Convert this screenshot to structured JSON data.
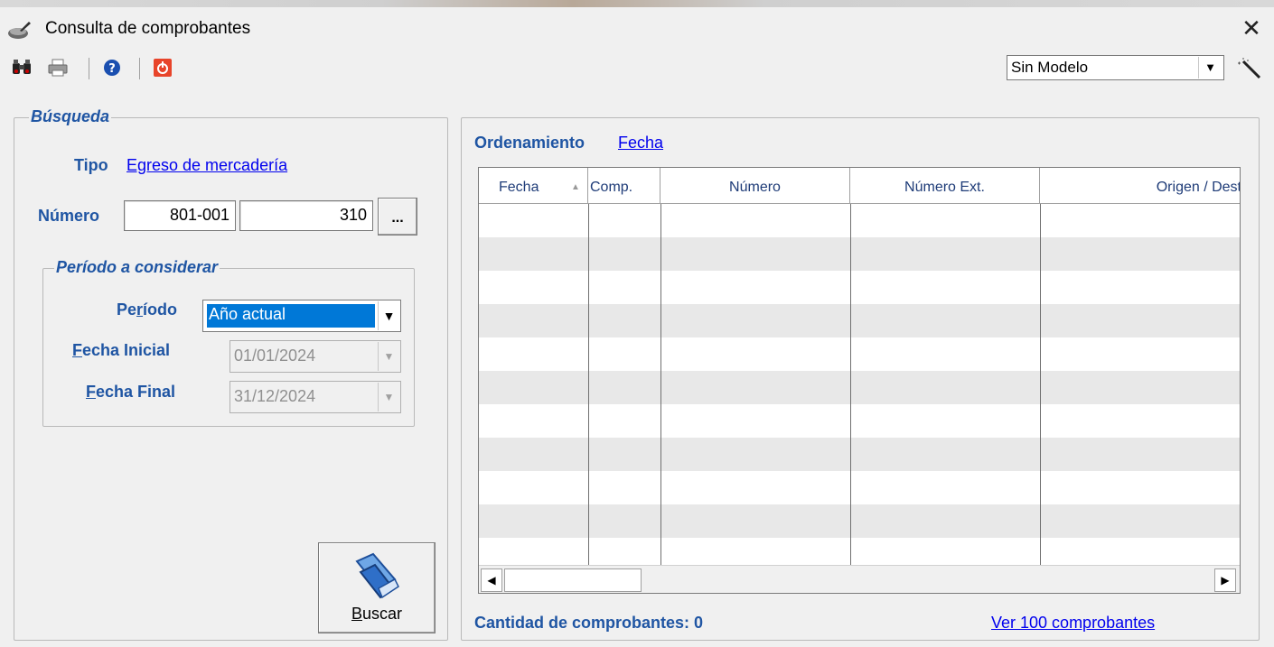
{
  "window": {
    "title": "Consulta de comprobantes",
    "close_glyph": "✕"
  },
  "toolbar": {
    "icons": [
      "binoculars-icon",
      "printer-icon",
      "help-icon",
      "power-icon"
    ],
    "model_select": {
      "value": "Sin Modelo"
    }
  },
  "busqueda": {
    "legend": "Búsqueda",
    "tipo_label": "Tipo",
    "tipo_value": "Egreso de mercadería",
    "numero_label": "Número",
    "numero_prefix": "801-001",
    "numero_value": "310",
    "ellipsis": "..."
  },
  "periodo": {
    "legend": "Período a considerar",
    "periodo_label_a": "Pe",
    "periodo_label_u": "r",
    "periodo_label_b": "íodo",
    "periodo_value": "Año actual",
    "fecha_inicial_label_u": "F",
    "fecha_inicial_label_b": "echa Inicial",
    "fecha_inicial_value": "01/01/2024",
    "fecha_final_label_u": "F",
    "fecha_final_label_b": "echa Final",
    "fecha_final_value": "31/12/2024"
  },
  "buscar": {
    "label_u": "B",
    "label_b": "uscar"
  },
  "results": {
    "ordenamiento_label": "Ordenamiento",
    "ordenamiento_value": "Fecha",
    "columns": [
      "Fecha",
      "Comp.",
      "Número",
      "Número Ext.",
      "Origen / Dest"
    ],
    "cantidad": "Cantidad de comprobantes: 0",
    "ver_link": "Ver 100 comprobantes"
  },
  "colors": {
    "label_blue": "#1f55a3",
    "link_blue": "#0000ee",
    "selection": "#0078d7",
    "row_alt": "#e8e8e8"
  }
}
